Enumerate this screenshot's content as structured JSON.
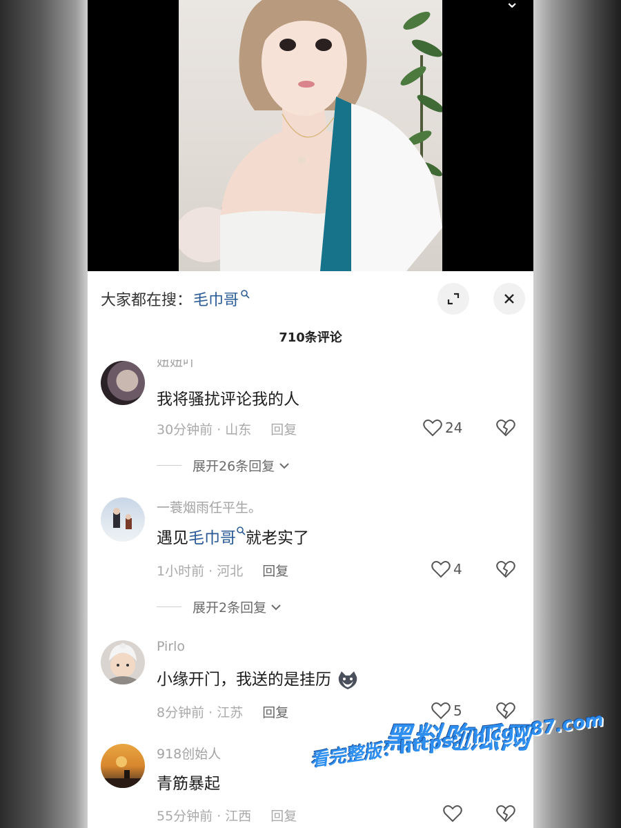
{
  "search": {
    "prefix": "大家都在搜：",
    "term": "毛巾哥"
  },
  "header": {
    "comment_count": "710条评论"
  },
  "comments": [
    {
      "username": "妞妞吖",
      "text": "我将骚扰评论我的人",
      "time_location": "30分钟前 · 山东",
      "reply_label": "回复",
      "likes": "24",
      "expand_label": "展开26条回复"
    },
    {
      "username": "一蓑烟雨任平生。",
      "text_before": "遇见",
      "text_highlight": "毛巾哥",
      "text_after": "就老实了",
      "time_location": "1小时前 · 河北",
      "reply_label": "回复",
      "likes": "4",
      "expand_label": "展开2条回复"
    },
    {
      "username": "Pirlo",
      "text": "小缘开门，我送的是挂历",
      "time_location": "8分钟前 · 江苏",
      "reply_label": "回复",
      "likes": "5"
    },
    {
      "username": "918创始人",
      "text": "青筋暴起",
      "time_location": "55分钟前 · 江西",
      "reply_label": "回复",
      "likes": ""
    }
  ],
  "watermark": {
    "title": "黑料吃瓜网",
    "url": "看完整版：https://hlcgw87.com"
  },
  "colors": {
    "highlight": "#2a5b96",
    "watermark": "#2e8ff0"
  }
}
